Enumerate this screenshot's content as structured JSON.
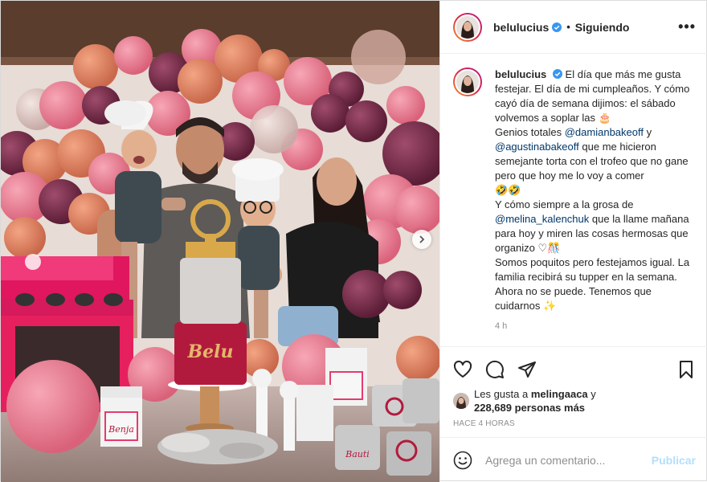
{
  "post": {
    "username": "belulucius",
    "dot": "•",
    "follow_status": "Siguiendo",
    "more": "•••",
    "time_ago": "4 h",
    "caption": {
      "username": "belulucius",
      "line1": "El día que más me gusta festejar. El día de mi cumpleaños. Y cómo cayó día de semana dijimos: el sábado volvemos a soplar las",
      "line2_pre": "Genios totales",
      "mention1": "@damianbakeoff",
      "and": "y",
      "mention2": "@agustinabakeoff",
      "line2_post": "que me hicieron semejante torta con el trofeo que no gane pero que hoy me lo voy a comer",
      "line3_pre": "Y cómo siempre a la grosa de",
      "mention3": "@melina_kalenchuk",
      "line3_post": "que la llame mañana para hoy y miren las cosas hermosas que organizo",
      "line4": "Somos poquitos pero festejamos igual. La familia recibirá su tupper en la semana. Ahora no se puede. Tenemos que cuidarnos"
    },
    "likes": {
      "prefix": "Les gusta a",
      "user": "melingaaca",
      "conj": "y",
      "count": "228,689 personas más"
    },
    "posted_label": "HACE 4 HORAS",
    "comment": {
      "placeholder": "Agrega un comentario...",
      "publish": "Publicar"
    },
    "cake_text": "Belu",
    "box_text_1": "Benja",
    "box_text_2": "Bauti"
  },
  "colors": {
    "verified": "#3897f0",
    "link": "#00376b",
    "publish_disabled": "#b2dffc",
    "muted": "#8e8e8e"
  },
  "icons": [
    "heart-icon",
    "comment-icon",
    "share-icon",
    "bookmark-icon",
    "smile-icon",
    "more-icon",
    "verified-icon",
    "chevron-right-icon"
  ]
}
